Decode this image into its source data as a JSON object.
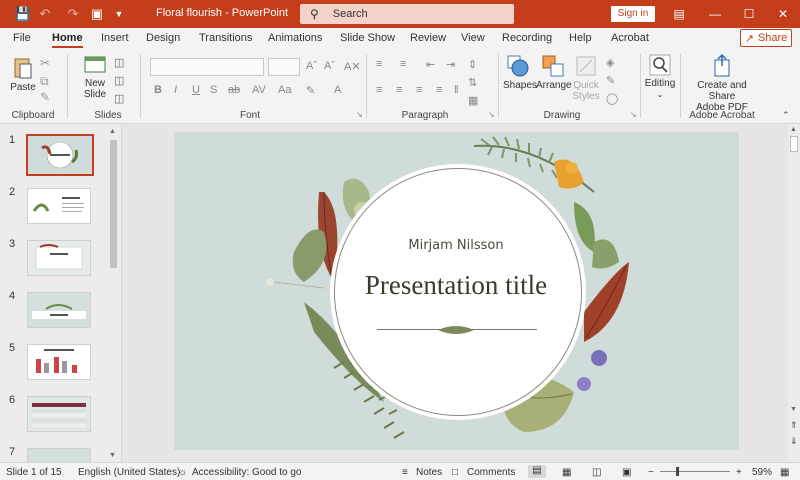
{
  "titlebar": {
    "doc_title": "Floral flourish  -  PowerPoint",
    "search_placeholder": "Search",
    "signin_label": "Sign in"
  },
  "tabs": [
    "File",
    "Home",
    "Insert",
    "Design",
    "Transitions",
    "Animations",
    "Slide Show",
    "Review",
    "View",
    "Recording",
    "Help",
    "Acrobat"
  ],
  "share_label": "Share",
  "ribbon": {
    "paste": "Paste",
    "new_slide_1": "New",
    "new_slide_2": "Slide",
    "shapes": "Shapes",
    "arrange": "Arrange",
    "quick_1": "Quick",
    "quick_2": "Styles",
    "editing": "Editing",
    "acro_1": "Create and Share",
    "acro_2": "Adobe PDF",
    "groups": {
      "clipboard": "Clipboard",
      "slides": "Slides",
      "font": "Font",
      "paragraph": "Paragraph",
      "drawing": "Drawing",
      "adobe": "Adobe Acrobat"
    }
  },
  "thumbs": [
    "1",
    "2",
    "3",
    "4",
    "5",
    "6",
    "7"
  ],
  "slide": {
    "subtitle": "Mirjam Nilsson",
    "title": "Presentation title"
  },
  "status": {
    "slide": "Slide 1 of 15",
    "language": "English (United States)",
    "accessibility": "Accessibility: Good to go",
    "notes": "Notes",
    "comments": "Comments",
    "zoom": "59%"
  },
  "colors": {
    "accent": "#c43e1c",
    "slide_bg": "#cfdcda"
  }
}
